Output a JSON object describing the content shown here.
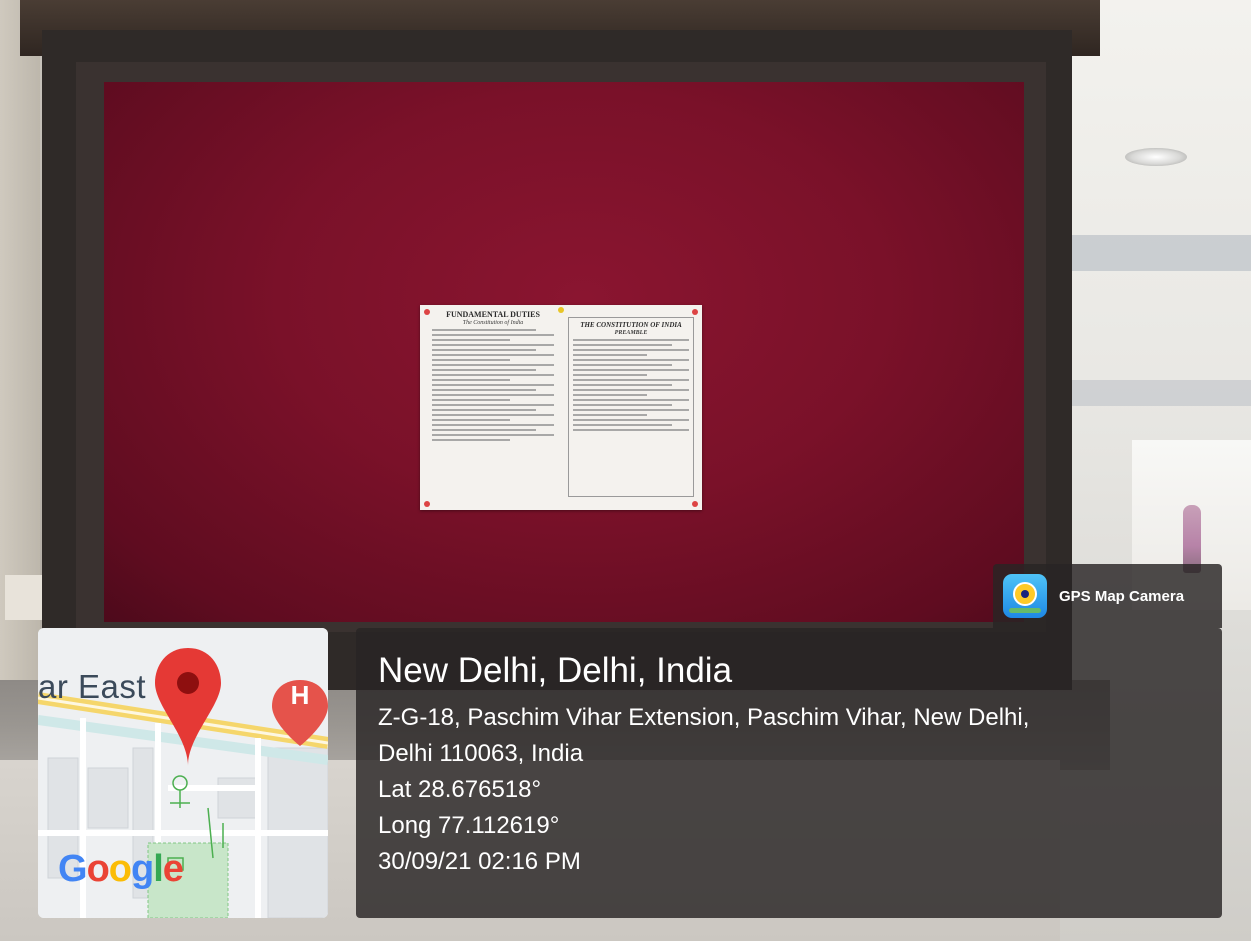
{
  "photo": {
    "poster": {
      "left_title": "FUNDAMENTAL DUTIES",
      "left_subtitle": "The Constitution of India",
      "right_title": "THE CONSTITUTION OF INDIA",
      "right_subtitle": "PREAMBLE"
    }
  },
  "map": {
    "place_label": "ar East",
    "hospital_marker": "H",
    "logo_letters": [
      {
        "char": "G",
        "color": "#4285F4"
      },
      {
        "char": "o",
        "color": "#EA4335"
      },
      {
        "char": "o",
        "color": "#FBBC05"
      },
      {
        "char": "g",
        "color": "#4285F4"
      },
      {
        "char": "l",
        "color": "#34A853"
      },
      {
        "char": "e",
        "color": "#EA4335"
      }
    ],
    "pin_color": "#E53935",
    "hospital_color": "#E5534B"
  },
  "badge": {
    "label": "GPS Map Camera"
  },
  "location": {
    "title": "New Delhi, Delhi, India",
    "address_line1": "Z-G-18, Paschim Vihar Extension, Paschim Vihar, New Delhi,",
    "address_line2": "Delhi 110063, India",
    "lat": "Lat 28.676518°",
    "long": "Long 77.112619°",
    "datetime": "30/09/21 02:16 PM"
  }
}
